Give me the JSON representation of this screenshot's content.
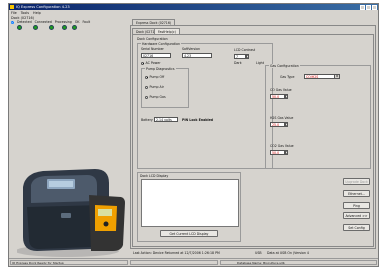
{
  "window": {
    "title": "IQ Express Configuration 4.23"
  },
  "menu": [
    "File",
    "Tools",
    "Help"
  ],
  "dock_panel": {
    "label": "Dock (02716)",
    "columns": [
      "Detected",
      "Connected",
      "Processing",
      "OK",
      "Fault"
    ]
  },
  "tabs": {
    "dock": "Express Dock (02716)",
    "inner": [
      "Dock (02716)",
      "FastHelp(c)"
    ]
  },
  "dock_configuration": {
    "heading": "Dock Configuration",
    "hardware": {
      "heading": "Hardware Configuration",
      "serial_label": "Serial Number",
      "serial_value": "02716",
      "software_label": "SoftVersion",
      "software_value": "4.23",
      "lcd_label": "LCD Contrast",
      "lcd_value": "7",
      "ac_power": "AC Power",
      "dark": "Dark",
      "light": "Light"
    },
    "pump": {
      "heading": "Pump Diagnostics",
      "options": [
        "Pump Off",
        "Pump Air",
        "Pump Gas"
      ],
      "selected_index": 0
    },
    "battery_label": "Battery",
    "battery_value": "2.14 volts",
    "pin_lock": "PIN Lock Enabled"
  },
  "gas_configuration": {
    "heading": "Gas Configuration",
    "gas_type_label": "Gas Type",
    "gas_type_value": "CO/H2S",
    "co_label": "CO Gas Value",
    "co_value": "50.0",
    "h2s_label": "H2S Gas Value",
    "h2s_value": "25.0",
    "co2_label": "CO2 Gas Value",
    "co2_value": "50.0"
  },
  "lcd_display": {
    "heading": "Dock LCD Display",
    "button": "Get Current LCD Display"
  },
  "side_buttons": {
    "upgrade": "Upgrade Dock",
    "ethernet": "Ethernet...",
    "ping": "Ping",
    "advanced": "Advanced >>",
    "set_config": "Set Config"
  },
  "status": {
    "left": "IQ Express Dock Ready for Startup",
    "mid": "Last Action: Device Returned at 12/7/2006 1:26:18 PM",
    "usb": "USB",
    "data": "Data at USB On (Version 4",
    "db": "Database Name: Bioculture.sdb"
  },
  "colors": {
    "led": "#1f9d1f",
    "pin_red": "#cc0000",
    "title_bar": "#0a246a"
  }
}
